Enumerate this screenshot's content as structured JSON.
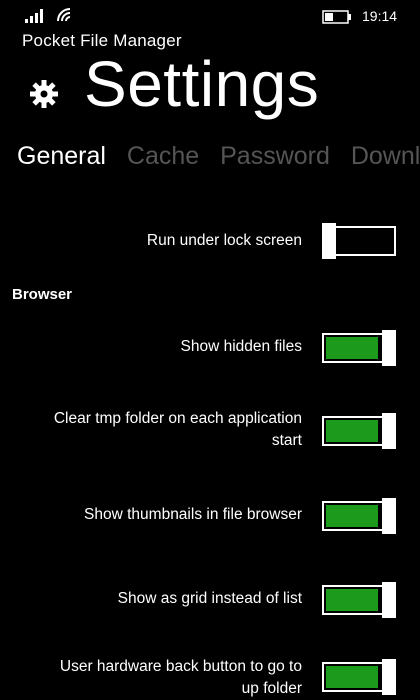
{
  "status": {
    "time": "19:14",
    "icons": [
      "signal-icon",
      "wifi-icon",
      "battery-icon"
    ]
  },
  "header": {
    "app_title": "Pocket File Manager",
    "page_title": "Settings",
    "icon": "gear-icon"
  },
  "tabs": [
    {
      "label": "General",
      "active": true
    },
    {
      "label": "Cache",
      "active": false
    },
    {
      "label": "Password",
      "active": false
    },
    {
      "label": "Downlo",
      "active": false
    }
  ],
  "settings": {
    "lock_screen": {
      "label": "Run under lock screen",
      "on": false
    },
    "browser_header": "Browser",
    "hidden_files": {
      "label": "Show hidden files",
      "on": true
    },
    "clear_tmp": {
      "label_line1": "Clear tmp folder on each application",
      "label_line2": "start",
      "on": true
    },
    "thumbnails": {
      "label": "Show thumbnails in file browser",
      "on": true
    },
    "grid": {
      "label": "Show as grid instead of list",
      "on": true
    },
    "back_button": {
      "label_line1": "User hardware back button to go to",
      "label_line2": "up folder",
      "on": true
    }
  },
  "colors": {
    "background": "#000000",
    "accent_on": "#1b9a1b",
    "tab_inactive": "#555555",
    "text": "#ffffff"
  }
}
